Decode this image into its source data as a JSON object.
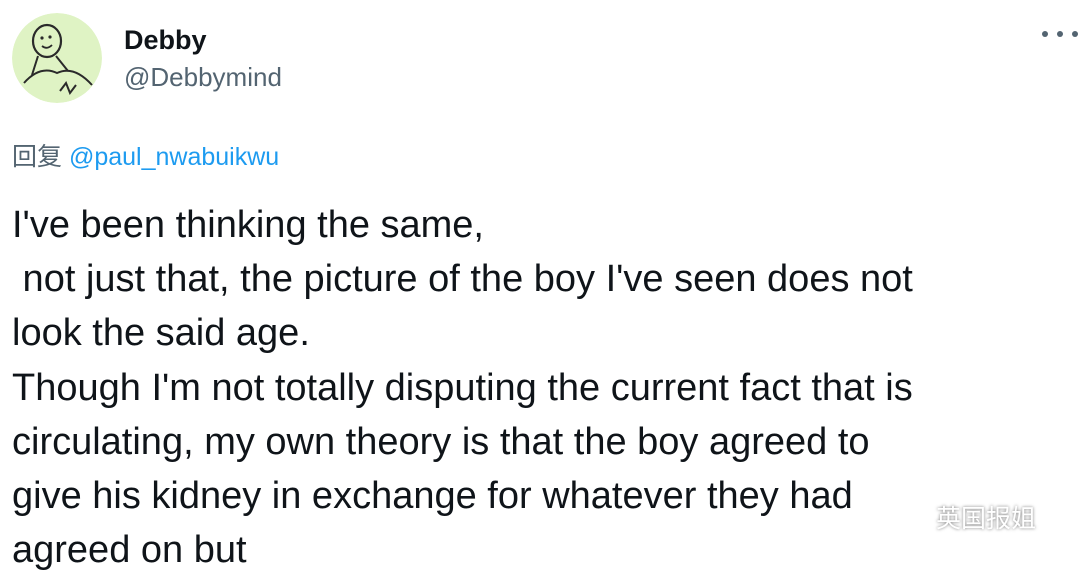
{
  "author": {
    "display_name": "Debby",
    "handle": "@Debbymind",
    "avatar_icon": "smiley-doodle-avatar"
  },
  "more_icon": "more-horizontal-icon",
  "reply": {
    "prefix": "回复",
    "mention": "@paul_nwabuikwu"
  },
  "tweet": {
    "lines": [
      "I've been thinking the same,",
      " not just that, the picture of the boy I've seen does not",
      "look the said age.",
      "Though I'm not totally disputing the current fact that is",
      "circulating, my own theory is that the boy agreed to",
      "give his kidney in exchange for whatever they had",
      "agreed on but"
    ]
  },
  "watermark": {
    "icon": "wechat-icon",
    "text": "英国报姐"
  },
  "colors": {
    "text": "#0f1419",
    "secondary": "#536471",
    "link": "#1d9bf0",
    "avatar_bg": "#dff3c4"
  }
}
